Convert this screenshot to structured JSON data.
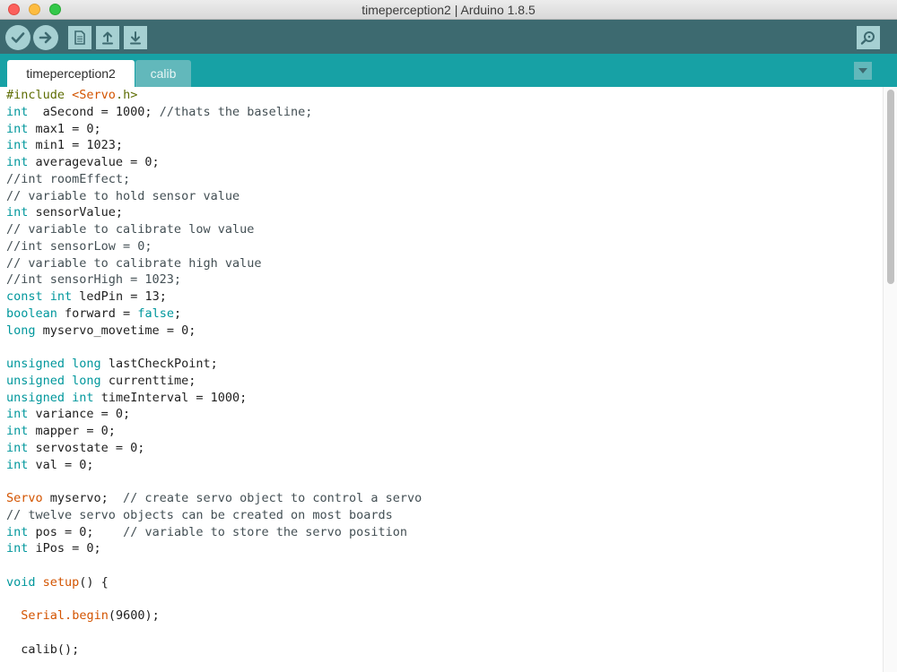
{
  "window": {
    "title": "timeperception2 | Arduino 1.8.5"
  },
  "toolbar": {
    "buttons": [
      {
        "name": "verify",
        "icon": "checkmark-icon"
      },
      {
        "name": "upload",
        "icon": "arrow-right-icon"
      },
      {
        "name": "new",
        "icon": "new-file-icon"
      },
      {
        "name": "open",
        "icon": "upload-arrow-icon"
      },
      {
        "name": "save",
        "icon": "download-arrow-icon"
      },
      {
        "name": "serial-monitor",
        "icon": "magnifier-icon"
      }
    ],
    "colors": {
      "background": "#3d6a70",
      "button": "#a6d0d2"
    }
  },
  "tabs": [
    {
      "label": "timeperception2",
      "active": true
    },
    {
      "label": "calib",
      "active": false
    }
  ],
  "editor": {
    "lines": [
      [
        [
          "pp",
          "#include "
        ],
        [
          "fn",
          "<Servo"
        ],
        [
          "pp",
          ".h>"
        ]
      ],
      [
        [
          "kw",
          "int"
        ],
        [
          "",
          "  aSecond = 1000; "
        ],
        [
          "cm",
          "//thats the baseline;"
        ]
      ],
      [
        [
          "kw",
          "int"
        ],
        [
          "",
          " max1 = 0;"
        ]
      ],
      [
        [
          "kw",
          "int"
        ],
        [
          "",
          " min1 = 1023;"
        ]
      ],
      [
        [
          "kw",
          "int"
        ],
        [
          "",
          " averagevalue = 0;"
        ]
      ],
      [
        [
          "cm",
          "//int roomEffect;"
        ]
      ],
      [
        [
          "cm",
          "// variable to hold sensor value"
        ]
      ],
      [
        [
          "kw",
          "int"
        ],
        [
          "",
          " sensorValue;"
        ]
      ],
      [
        [
          "cm",
          "// variable to calibrate low value"
        ]
      ],
      [
        [
          "cm",
          "//int sensorLow = 0;"
        ]
      ],
      [
        [
          "cm",
          "// variable to calibrate high value"
        ]
      ],
      [
        [
          "cm",
          "//int sensorHigh = 1023;"
        ]
      ],
      [
        [
          "kw",
          "const"
        ],
        [
          "",
          " "
        ],
        [
          "kw",
          "int"
        ],
        [
          "",
          " ledPin = 13;"
        ]
      ],
      [
        [
          "kw",
          "boolean"
        ],
        [
          "",
          " forward = "
        ],
        [
          "lit",
          "false"
        ],
        [
          "",
          ";"
        ]
      ],
      [
        [
          "kw",
          "long"
        ],
        [
          "",
          " myservo_movetime = 0;"
        ]
      ],
      [],
      [
        [
          "kw",
          "unsigned"
        ],
        [
          "",
          " "
        ],
        [
          "kw",
          "long"
        ],
        [
          "",
          " lastCheckPoint;"
        ]
      ],
      [
        [
          "kw",
          "unsigned"
        ],
        [
          "",
          " "
        ],
        [
          "kw",
          "long"
        ],
        [
          "",
          " currenttime;"
        ]
      ],
      [
        [
          "kw",
          "unsigned"
        ],
        [
          "",
          " "
        ],
        [
          "kw",
          "int"
        ],
        [
          "",
          " timeInterval = 1000;"
        ]
      ],
      [
        [
          "kw",
          "int"
        ],
        [
          "",
          " variance = 0;"
        ]
      ],
      [
        [
          "kw",
          "int"
        ],
        [
          "",
          " mapper = 0;"
        ]
      ],
      [
        [
          "kw",
          "int"
        ],
        [
          "",
          " servostate = 0;"
        ]
      ],
      [
        [
          "kw",
          "int"
        ],
        [
          "",
          " val = 0;"
        ]
      ],
      [],
      [
        [
          "fn",
          "Servo"
        ],
        [
          "",
          " myservo;  "
        ],
        [
          "cm",
          "// create servo object to control a servo"
        ]
      ],
      [
        [
          "cm",
          "// twelve servo objects can be created on most boards"
        ]
      ],
      [
        [
          "kw",
          "int"
        ],
        [
          "",
          " pos = 0;    "
        ],
        [
          "cm",
          "// variable to store the servo position"
        ]
      ],
      [
        [
          "kw",
          "int"
        ],
        [
          "",
          " iPos = 0;"
        ]
      ],
      [],
      [
        [
          "kw",
          "void"
        ],
        [
          "",
          " "
        ],
        [
          "fn",
          "setup"
        ],
        [
          "",
          "() {"
        ]
      ],
      [],
      [
        [
          "",
          "  "
        ],
        [
          "fn",
          "Serial"
        ],
        [
          "fn",
          "."
        ],
        [
          "fn",
          "begin"
        ],
        [
          "",
          "(9600);"
        ]
      ],
      [],
      [
        [
          "",
          "  calib();"
        ]
      ]
    ]
  }
}
